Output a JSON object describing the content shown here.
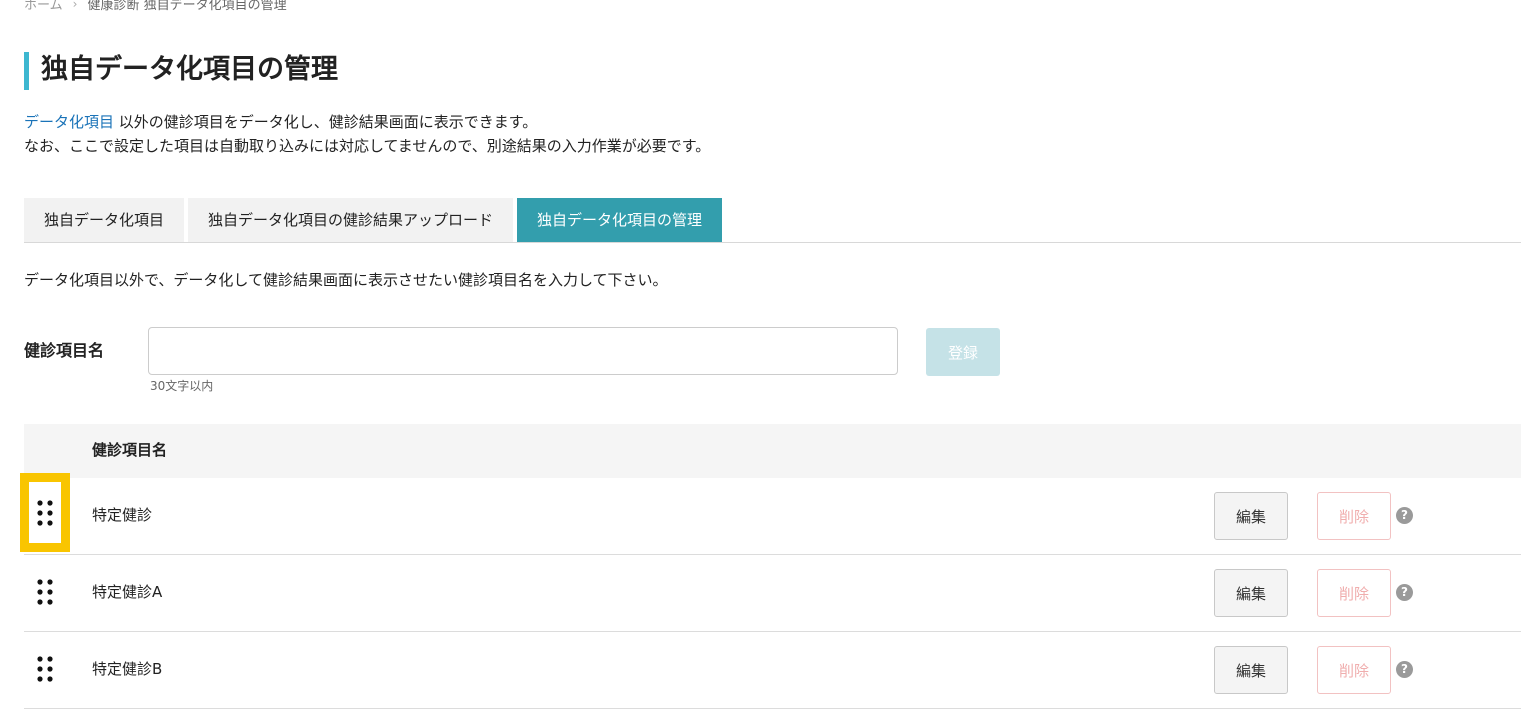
{
  "breadcrumb": {
    "home": "ホーム",
    "separator": "›",
    "current": "健康診断 独自データ化項目の管理"
  },
  "title": "独自データ化項目の管理",
  "description": {
    "link_text": "データ化項目",
    "line1_rest": " 以外の健診項目をデータ化し、健診結果画面に表示できます。",
    "line2": "なお、ここで設定した項目は自動取り込みには対応してませんので、別途結果の入力作業が必要です。"
  },
  "tabs": [
    {
      "label": "独自データ化項目",
      "active": false
    },
    {
      "label": "独自データ化項目の健診結果アップロード",
      "active": false
    },
    {
      "label": "独自データ化項目の管理",
      "active": true
    }
  ],
  "instruction": "データ化項目以外で、データ化して健診結果画面に表示させたい健診項目名を入力して下さい。",
  "form": {
    "label": "健診項目名",
    "value": "",
    "placeholder": "",
    "hint": "30文字以内",
    "submit_label": "登録"
  },
  "table": {
    "header": "健診項目名",
    "rows": [
      {
        "name": "特定健診",
        "edit_label": "編集",
        "delete_label": "削除",
        "help": "?"
      },
      {
        "name": "特定健診A",
        "edit_label": "編集",
        "delete_label": "削除",
        "help": "?"
      },
      {
        "name": "特定健診B",
        "edit_label": "編集",
        "delete_label": "削除",
        "help": "?"
      }
    ]
  },
  "colors": {
    "accent": "#339ead",
    "title_bar": "#3db7d0",
    "highlight": "#f9c500",
    "link": "#1a73b8",
    "delete_text": "#f0aeae"
  },
  "icons": {
    "drag_handle": "drag-handle-icon",
    "help": "help-icon"
  }
}
